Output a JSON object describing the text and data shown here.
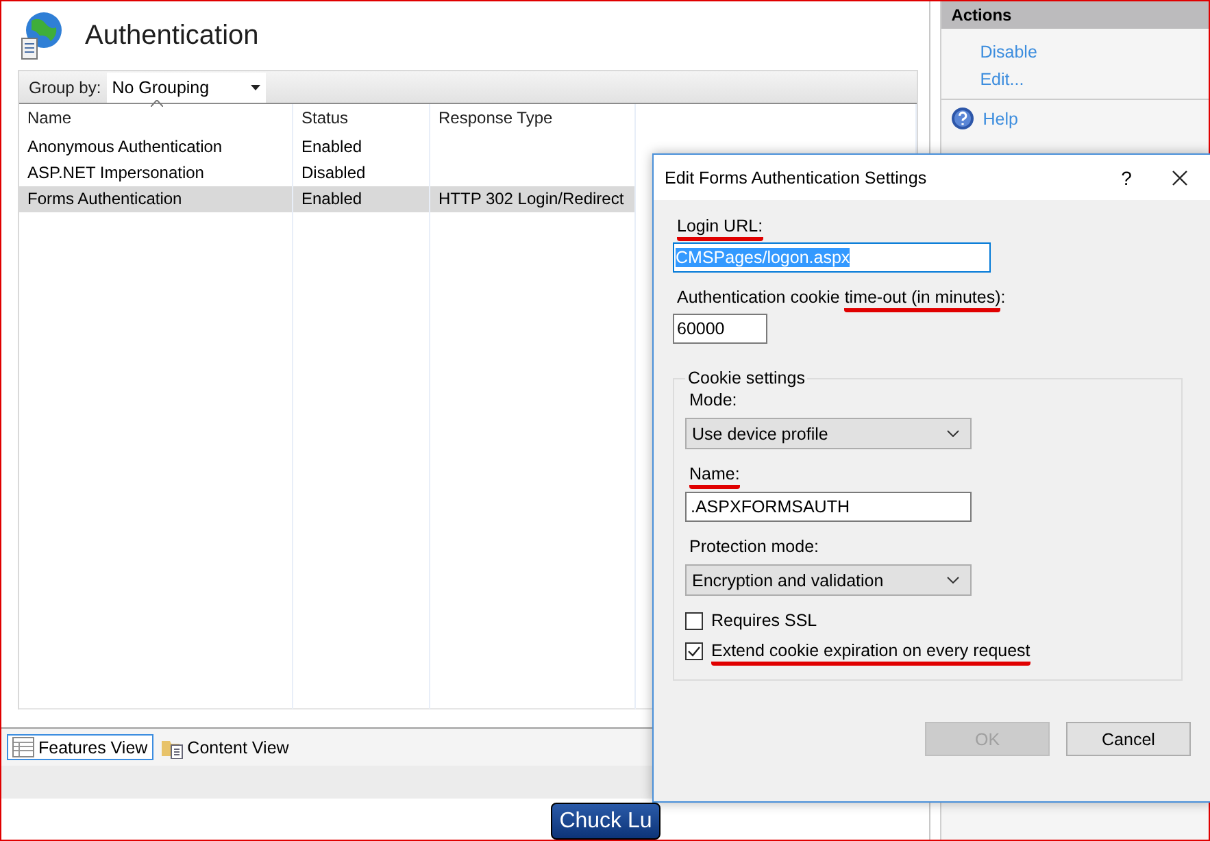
{
  "page": {
    "title": "Authentication"
  },
  "group_by": {
    "label": "Group by:",
    "value": "No Grouping"
  },
  "table": {
    "columns": [
      "Name",
      "Status",
      "Response Type"
    ],
    "rows": [
      {
        "name": "Anonymous Authentication",
        "status": "Enabled",
        "selected": false
      },
      {
        "name": "ASP.NET Impersonation",
        "status": "Disabled",
        "selected": false
      },
      {
        "name": "Forms Authentication",
        "status": "Enabled",
        "response_type": "HTTP 302 Login/Redirect",
        "selected": true
      }
    ]
  },
  "views": [
    {
      "label": "Features View",
      "kind": "features",
      "selected": true
    },
    {
      "label": "Content View",
      "kind": "content",
      "selected": false
    }
  ],
  "actions": {
    "title": "Actions",
    "items": [
      {
        "label": "Disable",
        "kind": "link"
      },
      {
        "label": "Edit...",
        "kind": "link"
      },
      {
        "label": "Help",
        "kind": "help"
      }
    ]
  },
  "dialog": {
    "title": "Edit Forms Authentication Settings",
    "help_button": "?",
    "login_url": {
      "label": [
        {
          "text": "Login URL:",
          "marked": true
        }
      ],
      "value": "CMSPages/logon.aspx",
      "text_selected": true
    },
    "timeout": {
      "label": [
        {
          "text": "Authentication cookie ",
          "marked": false
        },
        {
          "text": "time-out (in minutes)",
          "marked": true
        },
        {
          "text": ":",
          "marked": false
        }
      ],
      "value": "60000"
    },
    "cookie_settings": {
      "legend": "Cookie settings",
      "fields": [
        {
          "kind": "select",
          "label": [
            {
              "text": "Mode:",
              "marked": false
            }
          ],
          "value": "Use device profile"
        },
        {
          "kind": "text",
          "label": [
            {
              "text": "Name:",
              "marked": true
            }
          ],
          "value": ".ASPXFORMSAUTH"
        },
        {
          "kind": "select",
          "label": [
            {
              "text": "Protection mode:",
              "marked": false
            }
          ],
          "value": "Encryption and validation"
        },
        {
          "kind": "checkbox",
          "label": [
            {
              "text": "Requires SSL",
              "marked": false
            }
          ],
          "checked": false
        },
        {
          "kind": "checkbox",
          "label": [
            {
              "text": "Extend cookie expiration on every request",
              "marked": true
            }
          ],
          "checked": true
        }
      ]
    },
    "buttons": [
      {
        "label": "OK",
        "disabled": true
      },
      {
        "label": "Cancel",
        "disabled": false
      }
    ]
  },
  "badge": {
    "label": "Chuck Lu"
  }
}
